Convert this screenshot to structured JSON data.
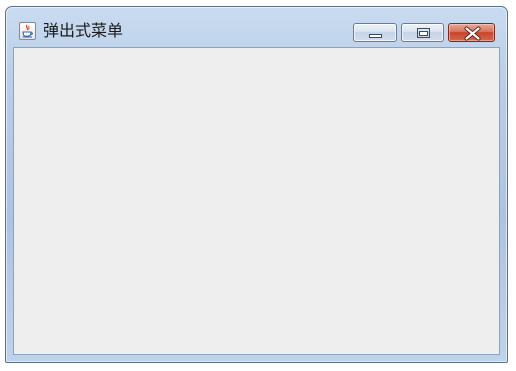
{
  "window": {
    "title": "弹出式菜单",
    "icon": "java-app-icon",
    "controls": {
      "minimize_icon": "minimize-icon",
      "maximize_icon": "maximize-icon",
      "close_icon": "close-icon"
    }
  },
  "colors": {
    "frame": "#b8cfea",
    "client_background": "#eeeeee",
    "close_button": "#c6452b"
  }
}
